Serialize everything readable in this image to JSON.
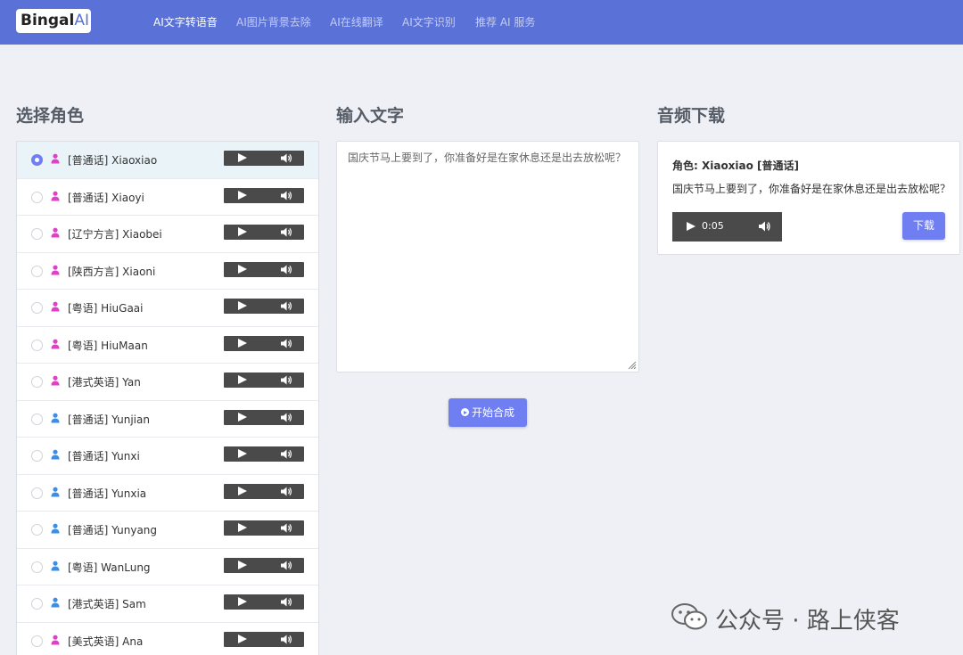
{
  "nav": {
    "logo_main": "Bingal",
    "logo_ai": "AI",
    "links": [
      {
        "label": "AI文字转语音",
        "active": true
      },
      {
        "label": "AI图片背景去除",
        "active": false
      },
      {
        "label": "AI在线翻译",
        "active": false
      },
      {
        "label": "AI文字识别",
        "active": false
      },
      {
        "label": "推荐 AI 服务",
        "active": false
      }
    ]
  },
  "sections": {
    "voices_title": "选择角色",
    "input_title": "输入文字",
    "download_title": "音频下载"
  },
  "voices": [
    {
      "label": "[普通话] Xiaoxiao",
      "gender": "female",
      "selected": true
    },
    {
      "label": "[普通话] Xiaoyi",
      "gender": "female",
      "selected": false
    },
    {
      "label": "[辽宁方言] Xiaobei",
      "gender": "female",
      "selected": false
    },
    {
      "label": "[陕西方言] Xiaoni",
      "gender": "female",
      "selected": false
    },
    {
      "label": "[粤语] HiuGaai",
      "gender": "female",
      "selected": false
    },
    {
      "label": "[粤语] HiuMaan",
      "gender": "female",
      "selected": false
    },
    {
      "label": "[港式英语] Yan",
      "gender": "female",
      "selected": false
    },
    {
      "label": "[普通话] Yunjian",
      "gender": "male",
      "selected": false
    },
    {
      "label": "[普通话] Yunxi",
      "gender": "male",
      "selected": false
    },
    {
      "label": "[普通话] Yunxia",
      "gender": "male",
      "selected": false
    },
    {
      "label": "[普通话] Yunyang",
      "gender": "male",
      "selected": false
    },
    {
      "label": "[粤语] WanLung",
      "gender": "male",
      "selected": false
    },
    {
      "label": "[港式英语] Sam",
      "gender": "male",
      "selected": false
    },
    {
      "label": "[美式英语] Ana",
      "gender": "female",
      "selected": false
    }
  ],
  "input": {
    "text": "国庆节马上要到了，你准备好是在家休息还是出去放松呢？"
  },
  "synth_button": "开始合成",
  "download": {
    "role": "角色: Xiaoxiao [普通话]",
    "text": "国庆节马上要到了，你准备好是在家休息还是出去放松呢？",
    "time": "0:05",
    "button": "下载"
  },
  "watermark": "公众号 · 路上侠客",
  "colors": {
    "nav_bg": "#5a72d8",
    "accent": "#6f7ef0",
    "female_icon": "#e040c8",
    "male_icon": "#3a8ee6"
  }
}
